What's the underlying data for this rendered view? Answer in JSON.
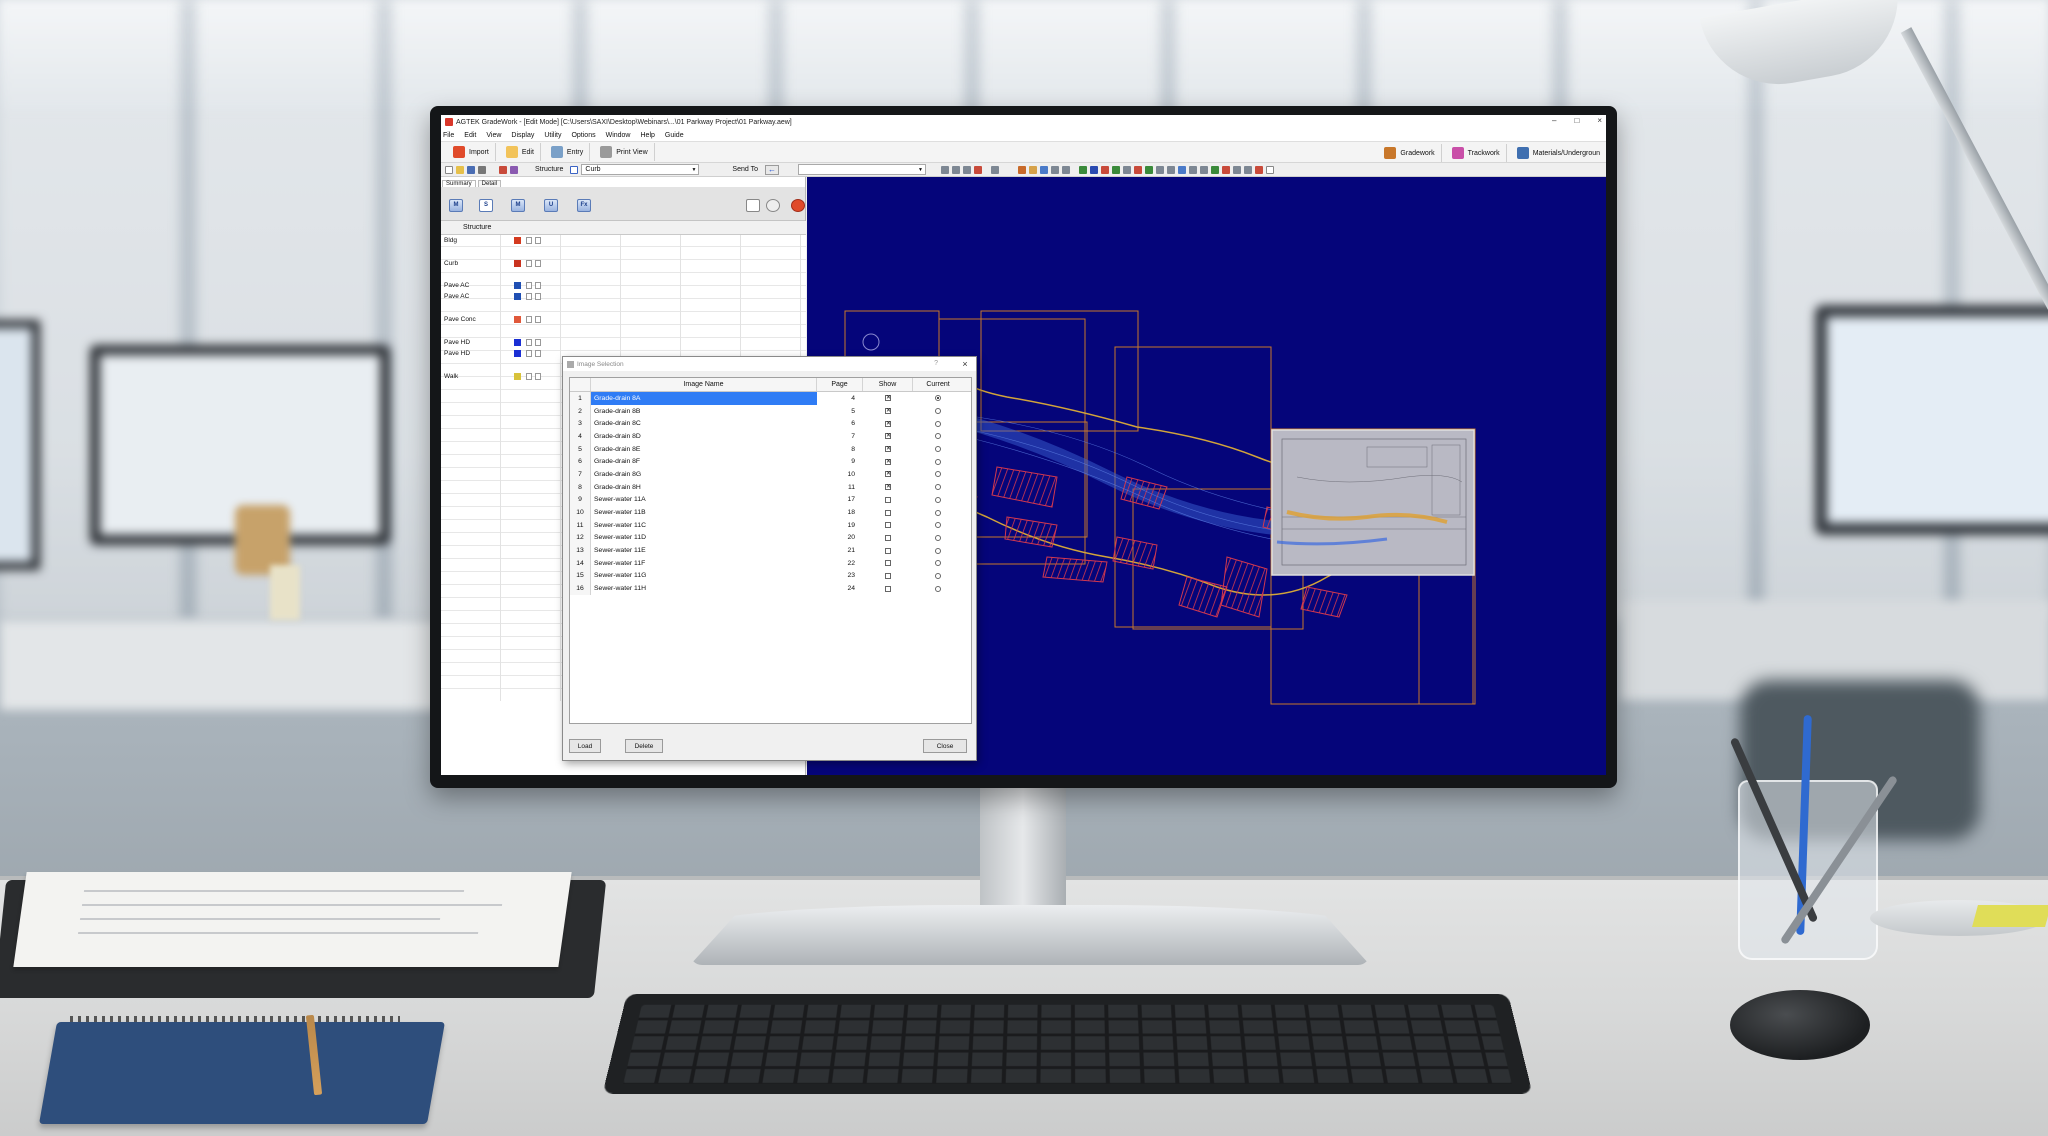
{
  "window": {
    "title": "AGTEK GradeWork - [Edit Mode] [C:\\Users\\SAXI\\Desktop\\Webinars\\...\\01 Parkway Project\\01 Parkway.aew]",
    "controls": [
      "–",
      "□",
      "×"
    ]
  },
  "menu": [
    "File",
    "Edit",
    "View",
    "Display",
    "Utility",
    "Options",
    "Window",
    "Help",
    "Guide"
  ],
  "modes": {
    "import": "Import",
    "edit": "Edit",
    "entry": "Entry",
    "print_view": "Print View",
    "gradework": "Gradework",
    "trackwork": "Trackwork",
    "material": "Materials/Undergroun"
  },
  "toolbar": {
    "structure_label": "Structure",
    "structure_value": "Curb",
    "send_to_label": "Send To"
  },
  "left_panel": {
    "tabs": [
      "Summary",
      "Detail"
    ],
    "tool_icons": [
      "M",
      "S",
      "M",
      "U",
      "Fx"
    ],
    "column_header": "Structure",
    "rows": [
      {
        "name": "Bldg",
        "color": "#d43a1f"
      },
      {
        "name": "Curb",
        "color": "#c9331f"
      },
      {
        "name": "Pave AC",
        "color": "#1f4fb3"
      },
      {
        "name": "Pave AC",
        "color": "#1f4fb3"
      },
      {
        "name": "Pave Conc",
        "color": "#e0583a"
      },
      {
        "name": "Pave HD",
        "color": "#1a2fd4"
      },
      {
        "name": "Pave HD",
        "color": "#1a2fd4"
      },
      {
        "name": "Walk",
        "color": "#d8c23a"
      }
    ]
  },
  "dialog": {
    "title": "Image Selection",
    "help": "?",
    "close": "×",
    "columns": {
      "name": "Image Name",
      "page": "Page",
      "show": "Show",
      "current": "Current"
    },
    "rows": [
      {
        "num": "1",
        "name": "Grade-drain 8A",
        "page": "4",
        "show": true,
        "current": true,
        "selected": true
      },
      {
        "num": "2",
        "name": "Grade-drain 8B",
        "page": "5",
        "show": true,
        "current": false
      },
      {
        "num": "3",
        "name": "Grade-drain 8C",
        "page": "6",
        "show": true,
        "current": false
      },
      {
        "num": "4",
        "name": "Grade-drain 8D",
        "page": "7",
        "show": true,
        "current": false
      },
      {
        "num": "5",
        "name": "Grade-drain 8E",
        "page": "8",
        "show": true,
        "current": false
      },
      {
        "num": "6",
        "name": "Grade-drain 8F",
        "page": "9",
        "show": true,
        "current": false
      },
      {
        "num": "7",
        "name": "Grade-drain 8G",
        "page": "10",
        "show": true,
        "current": false
      },
      {
        "num": "8",
        "name": "Grade-drain 8H",
        "page": "11",
        "show": true,
        "current": false
      },
      {
        "num": "9",
        "name": "Sewer-water 11A",
        "page": "17",
        "show": false,
        "current": false
      },
      {
        "num": "10",
        "name": "Sewer-water 11B",
        "page": "18",
        "show": false,
        "current": false
      },
      {
        "num": "11",
        "name": "Sewer-water 11C",
        "page": "19",
        "show": false,
        "current": false
      },
      {
        "num": "12",
        "name": "Sewer-water 11D",
        "page": "20",
        "show": false,
        "current": false
      },
      {
        "num": "13",
        "name": "Sewer-water 11E",
        "page": "21",
        "show": false,
        "current": false
      },
      {
        "num": "14",
        "name": "Sewer-water 11F",
        "page": "22",
        "show": false,
        "current": false
      },
      {
        "num": "15",
        "name": "Sewer-water 11G",
        "page": "23",
        "show": false,
        "current": false
      },
      {
        "num": "16",
        "name": "Sewer-water 11H",
        "page": "24",
        "show": false,
        "current": false
      }
    ],
    "buttons": {
      "load": "Load",
      "delete": "Delete",
      "close": "Close"
    }
  },
  "colors": {
    "canvas": "#05057a",
    "selection": "#2f7cf5",
    "sheet_outline": "#c8782a",
    "hatch": "#d2384f"
  }
}
